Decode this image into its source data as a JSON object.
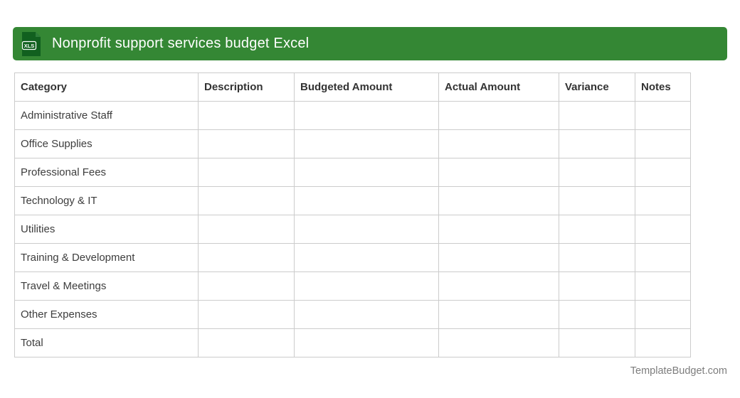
{
  "header": {
    "title": "Nonprofit support services budget Excel",
    "file_badge": "XLS"
  },
  "colors": {
    "bar_green": "#348734",
    "icon_dark_green": "#11601f",
    "icon_fold_green": "#2e7d3a",
    "table_border": "#cccccc",
    "header_text": "#333333",
    "body_text": "#3d3d3d",
    "footer_text": "#7d7d7d"
  },
  "table": {
    "columns": [
      "Category",
      "Description",
      "Budgeted Amount",
      "Actual Amount",
      "Variance",
      "Notes"
    ],
    "rows": [
      {
        "category": "Administrative Staff",
        "description": "",
        "budgeted": "",
        "actual": "",
        "variance": "",
        "notes": ""
      },
      {
        "category": "Office Supplies",
        "description": "",
        "budgeted": "",
        "actual": "",
        "variance": "",
        "notes": ""
      },
      {
        "category": "Professional Fees",
        "description": "",
        "budgeted": "",
        "actual": "",
        "variance": "",
        "notes": ""
      },
      {
        "category": "Technology & IT",
        "description": "",
        "budgeted": "",
        "actual": "",
        "variance": "",
        "notes": ""
      },
      {
        "category": "Utilities",
        "description": "",
        "budgeted": "",
        "actual": "",
        "variance": "",
        "notes": ""
      },
      {
        "category": "Training & Development",
        "description": "",
        "budgeted": "",
        "actual": "",
        "variance": "",
        "notes": ""
      },
      {
        "category": "Travel & Meetings",
        "description": "",
        "budgeted": "",
        "actual": "",
        "variance": "",
        "notes": ""
      },
      {
        "category": "Other Expenses",
        "description": "",
        "budgeted": "",
        "actual": "",
        "variance": "",
        "notes": ""
      },
      {
        "category": "Total",
        "description": "",
        "budgeted": "",
        "actual": "",
        "variance": "",
        "notes": ""
      }
    ]
  },
  "footer": {
    "watermark": "TemplateBudget.com"
  }
}
